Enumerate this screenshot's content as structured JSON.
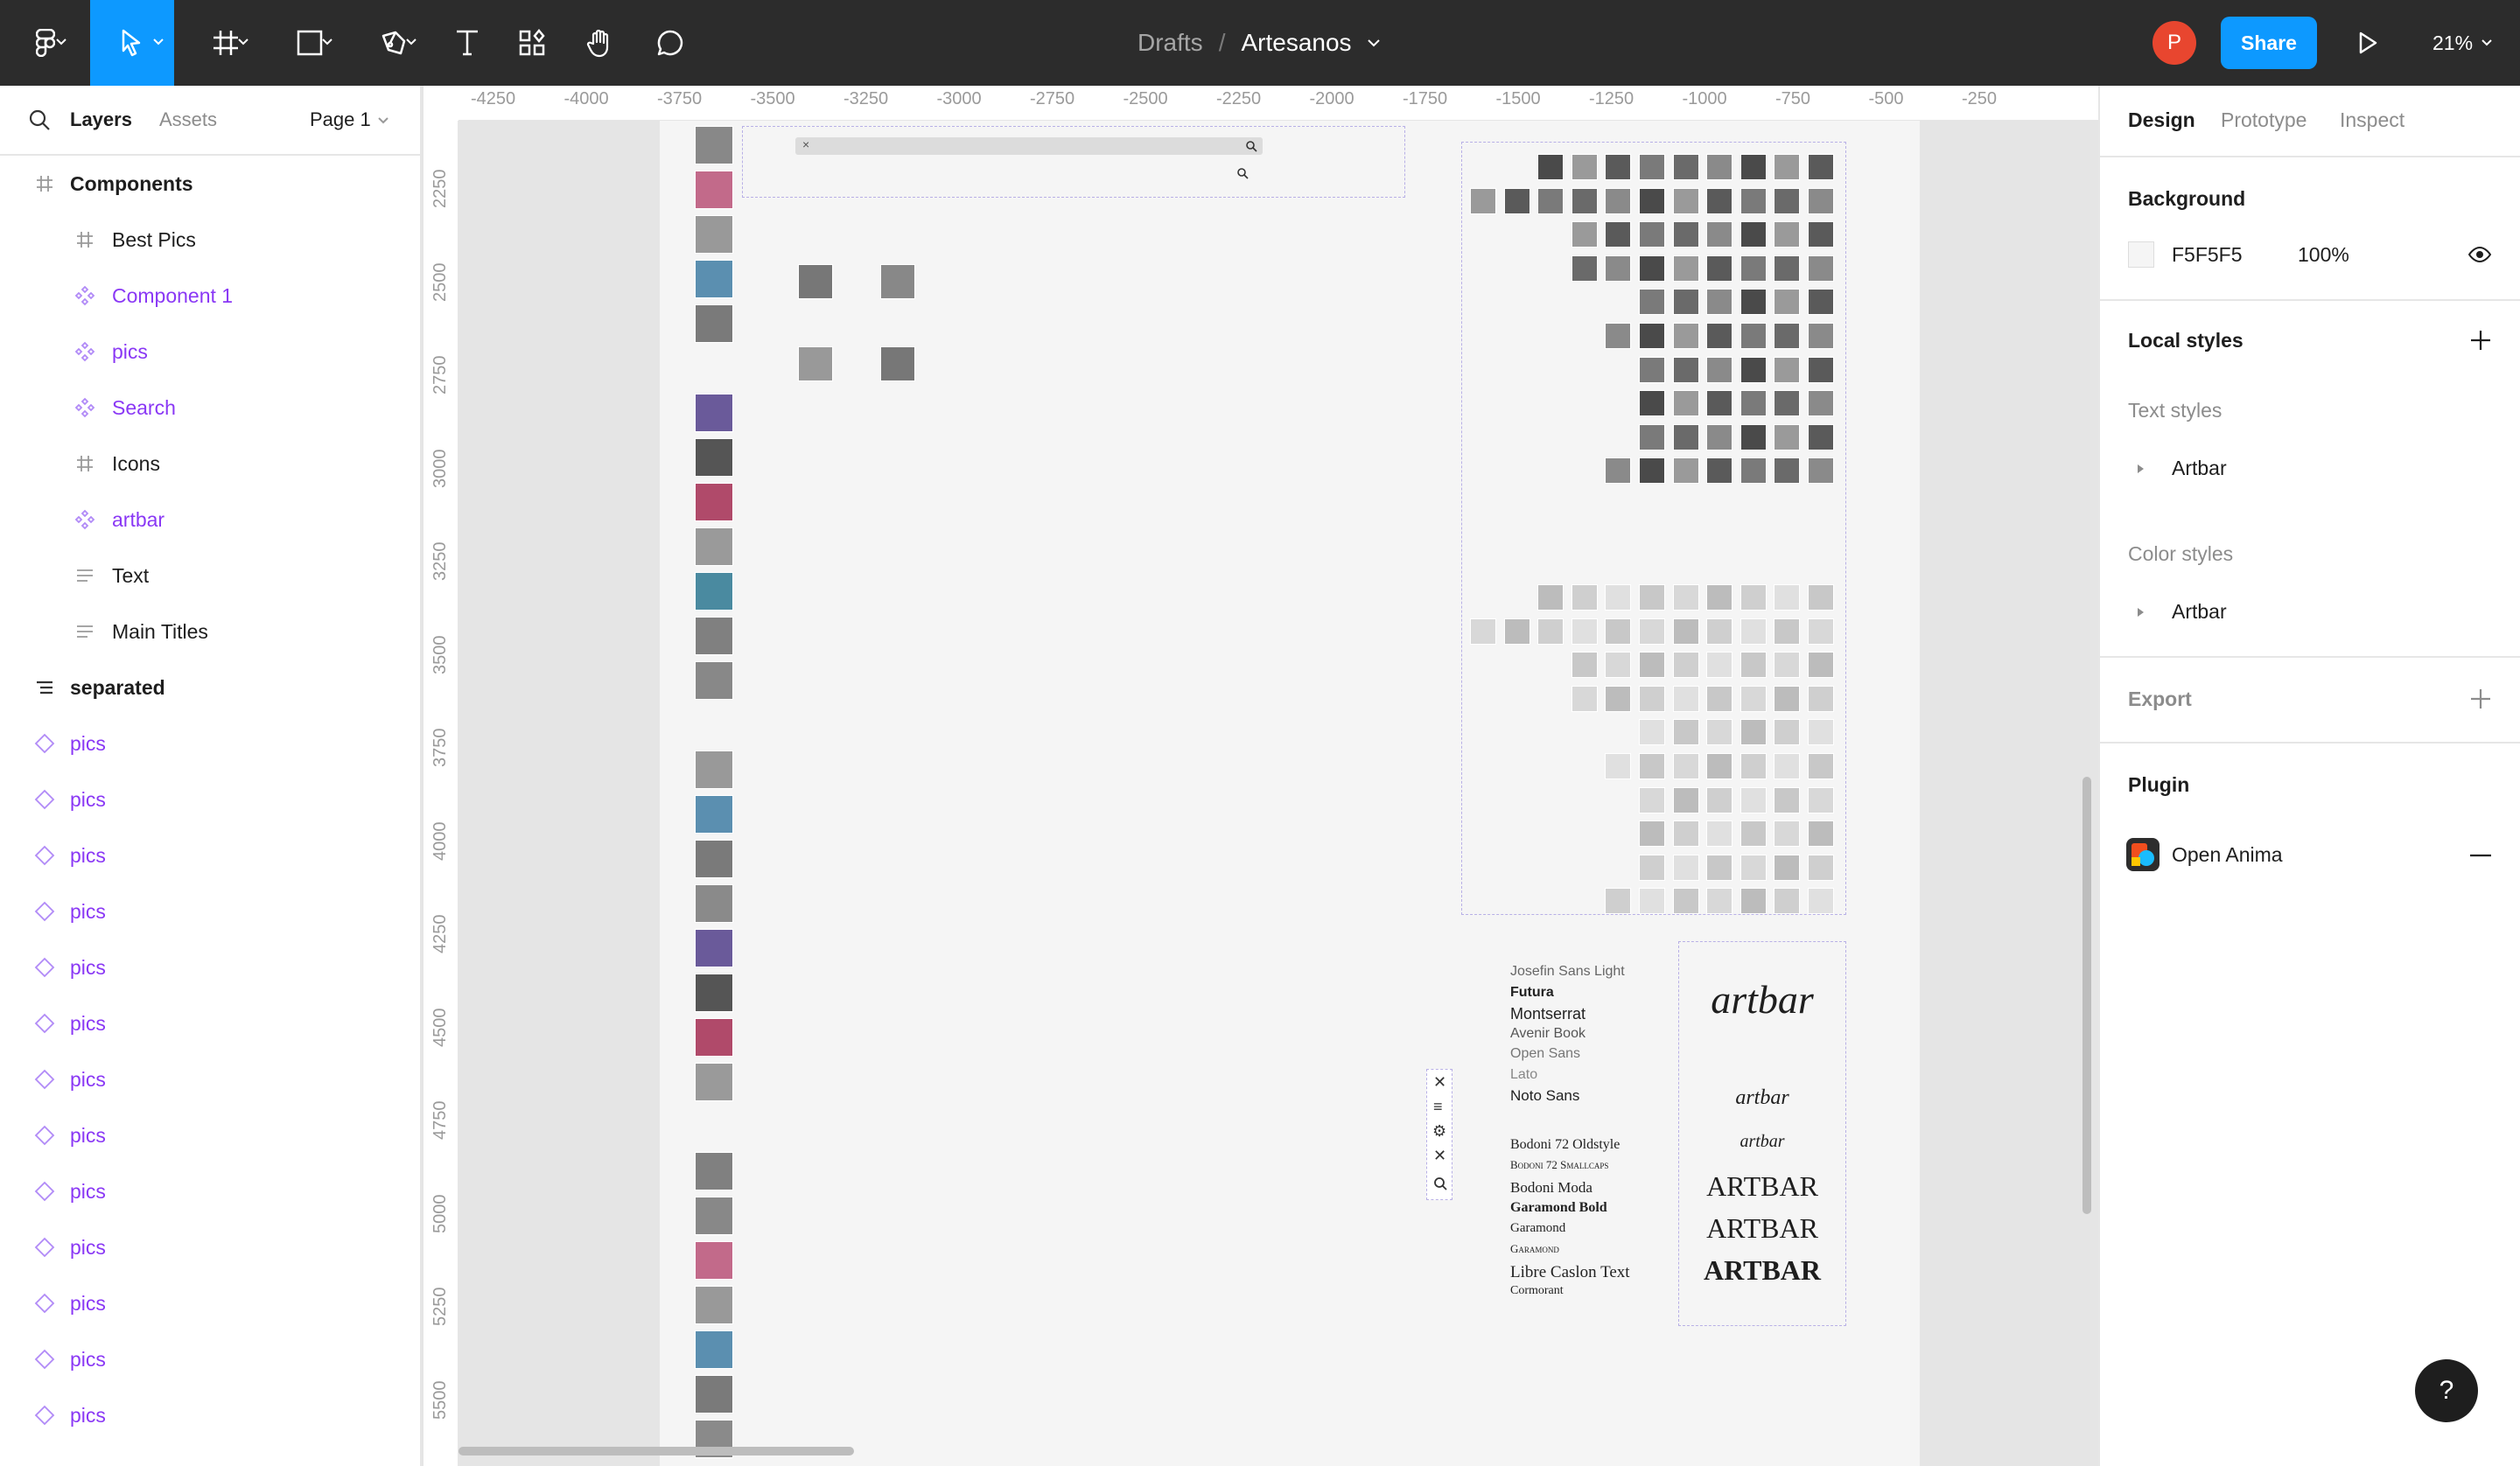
{
  "toolbar": {
    "breadcrumb": "Drafts",
    "separator": "/",
    "file_name": "Artesanos",
    "avatar_initial": "P",
    "share_label": "Share",
    "zoom": "21%"
  },
  "left_panel": {
    "tabs": {
      "layers": "Layers",
      "assets": "Assets"
    },
    "page_selector": "Page 1",
    "layers": [
      {
        "label": "Components",
        "type": "frame",
        "bold": true
      },
      {
        "label": "Best Pics",
        "type": "frame"
      },
      {
        "label": "Component 1",
        "type": "component"
      },
      {
        "label": "pics",
        "type": "component"
      },
      {
        "label": "Search",
        "type": "component"
      },
      {
        "label": "Icons",
        "type": "frame"
      },
      {
        "label": "artbar",
        "type": "component"
      },
      {
        "label": "Text",
        "type": "text-group"
      },
      {
        "label": "Main Titles",
        "type": "text-group"
      },
      {
        "label": "separated",
        "type": "group",
        "bold": true
      },
      {
        "label": "pics",
        "type": "instance"
      },
      {
        "label": "pics",
        "type": "instance"
      },
      {
        "label": "pics",
        "type": "instance"
      },
      {
        "label": "pics",
        "type": "instance"
      },
      {
        "label": "pics",
        "type": "instance"
      },
      {
        "label": "pics",
        "type": "instance"
      },
      {
        "label": "pics",
        "type": "instance"
      },
      {
        "label": "pics",
        "type": "instance"
      },
      {
        "label": "pics",
        "type": "instance"
      },
      {
        "label": "pics",
        "type": "instance"
      },
      {
        "label": "pics",
        "type": "instance"
      },
      {
        "label": "pics",
        "type": "instance"
      },
      {
        "label": "pics",
        "type": "instance"
      }
    ]
  },
  "canvas": {
    "ruler_x": [
      "-4250",
      "-4000",
      "-3750",
      "-3500",
      "-3250",
      "-3000",
      "-2750",
      "-2500",
      "-2250",
      "-2000",
      "-1750",
      "-1500",
      "-1250",
      "-1000",
      "-750",
      "-500",
      "-250"
    ],
    "ruler_y": [
      "2250",
      "2500",
      "2750",
      "3000",
      "3250",
      "3500",
      "3750",
      "4000",
      "4250",
      "4500",
      "4750",
      "5000",
      "5250",
      "5500"
    ],
    "fonts_sans": [
      "Josefin Sans Light",
      "Futura",
      "Montserrat",
      "Avenir Book",
      "Open Sans",
      "Lato",
      "Noto Sans"
    ],
    "fonts_serif": [
      "Bodoni 72 Oldstyle",
      "Bodoni 72 Smallcaps",
      "Bodoni Moda",
      "Garamond Bold",
      "Garamond",
      "Garamond",
      "Libre Caslon Text",
      "Cormorant"
    ],
    "artbar_samples": [
      "artbar",
      "artbar",
      "artbar",
      "ARTBAR",
      "ARTBAR",
      "ARTBAR"
    ]
  },
  "right_panel": {
    "tabs": {
      "design": "Design",
      "prototype": "Prototype",
      "inspect": "Inspect"
    },
    "background_title": "Background",
    "background_hex": "F5F5F5",
    "background_opacity": "100%",
    "local_styles_title": "Local styles",
    "text_styles_label": "Text styles",
    "text_style_item": "Artbar",
    "color_styles_label": "Color styles",
    "color_style_item": "Artbar",
    "export_title": "Export",
    "plugin_title": "Plugin",
    "plugin_name": "Open Anima"
  },
  "colors": {
    "toolbar_bg": "#2c2c2c",
    "accent": "#0d99ff",
    "component_purple": "#8a38f5",
    "avatar": "#e8462f"
  },
  "help_label": "?"
}
